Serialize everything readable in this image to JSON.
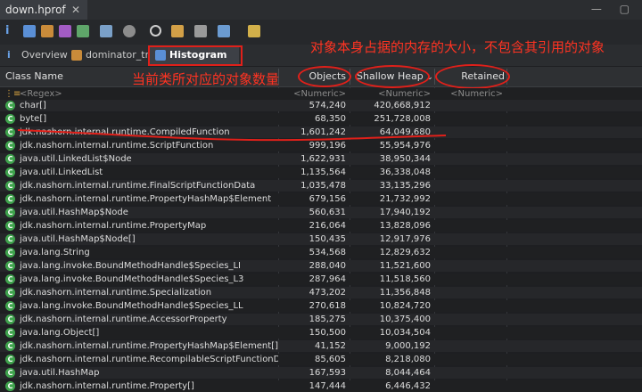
{
  "file_tab": {
    "name": "down.hprof",
    "close": "✕"
  },
  "tabs": [
    {
      "label": "Overview"
    },
    {
      "label": "dominator_tree"
    },
    {
      "label": "Histogram",
      "close": "✕"
    }
  ],
  "columns": {
    "class_name": "Class Name",
    "objects": "Objects",
    "shallow": "Shallow Heap",
    "sort_arrow": "⌄",
    "retained": "Retained Heap"
  },
  "filters": {
    "regex": "<Regex>",
    "numeric": "<Numeric>"
  },
  "annotations": {
    "top": "对象本身占据的内存的大小，不包含其引用的对象",
    "left": "当前类所对应的对象数量"
  },
  "rows": [
    {
      "name": "char[]",
      "objects": "574,240",
      "shallow": "420,668,912"
    },
    {
      "name": "byte[]",
      "objects": "68,350",
      "shallow": "251,728,008"
    },
    {
      "name": "jdk.nashorn.internal.runtime.CompiledFunction",
      "objects": "1,601,242",
      "shallow": "64,049,680"
    },
    {
      "name": "jdk.nashorn.internal.runtime.ScriptFunction",
      "objects": "999,196",
      "shallow": "55,954,976"
    },
    {
      "name": "java.util.LinkedList$Node",
      "objects": "1,622,931",
      "shallow": "38,950,344"
    },
    {
      "name": "java.util.LinkedList",
      "objects": "1,135,564",
      "shallow": "36,338,048"
    },
    {
      "name": "jdk.nashorn.internal.runtime.FinalScriptFunctionData",
      "objects": "1,035,478",
      "shallow": "33,135,296"
    },
    {
      "name": "jdk.nashorn.internal.runtime.PropertyHashMap$Element",
      "objects": "679,156",
      "shallow": "21,732,992"
    },
    {
      "name": "java.util.HashMap$Node",
      "objects": "560,631",
      "shallow": "17,940,192"
    },
    {
      "name": "jdk.nashorn.internal.runtime.PropertyMap",
      "objects": "216,064",
      "shallow": "13,828,096"
    },
    {
      "name": "java.util.HashMap$Node[]",
      "objects": "150,435",
      "shallow": "12,917,976"
    },
    {
      "name": "java.lang.String",
      "objects": "534,568",
      "shallow": "12,829,632"
    },
    {
      "name": "java.lang.invoke.BoundMethodHandle$Species_LI",
      "objects": "288,040",
      "shallow": "11,521,600"
    },
    {
      "name": "java.lang.invoke.BoundMethodHandle$Species_L3",
      "objects": "287,964",
      "shallow": "11,518,560"
    },
    {
      "name": "jdk.nashorn.internal.runtime.Specialization",
      "objects": "473,202",
      "shallow": "11,356,848"
    },
    {
      "name": "java.lang.invoke.BoundMethodHandle$Species_LL",
      "objects": "270,618",
      "shallow": "10,824,720"
    },
    {
      "name": "jdk.nashorn.internal.runtime.AccessorProperty",
      "objects": "185,275",
      "shallow": "10,375,400"
    },
    {
      "name": "java.lang.Object[]",
      "objects": "150,500",
      "shallow": "10,034,504"
    },
    {
      "name": "jdk.nashorn.internal.runtime.PropertyHashMap$Element[]",
      "objects": "41,152",
      "shallow": "9,000,192"
    },
    {
      "name": "jdk.nashorn.internal.runtime.RecompilableScriptFunctionData",
      "objects": "85,605",
      "shallow": "8,218,080"
    },
    {
      "name": "java.util.HashMap",
      "objects": "167,593",
      "shallow": "8,044,464"
    },
    {
      "name": "jdk.nashorn.internal.runtime.Property[]",
      "objects": "147,444",
      "shallow": "6,446,432"
    }
  ]
}
